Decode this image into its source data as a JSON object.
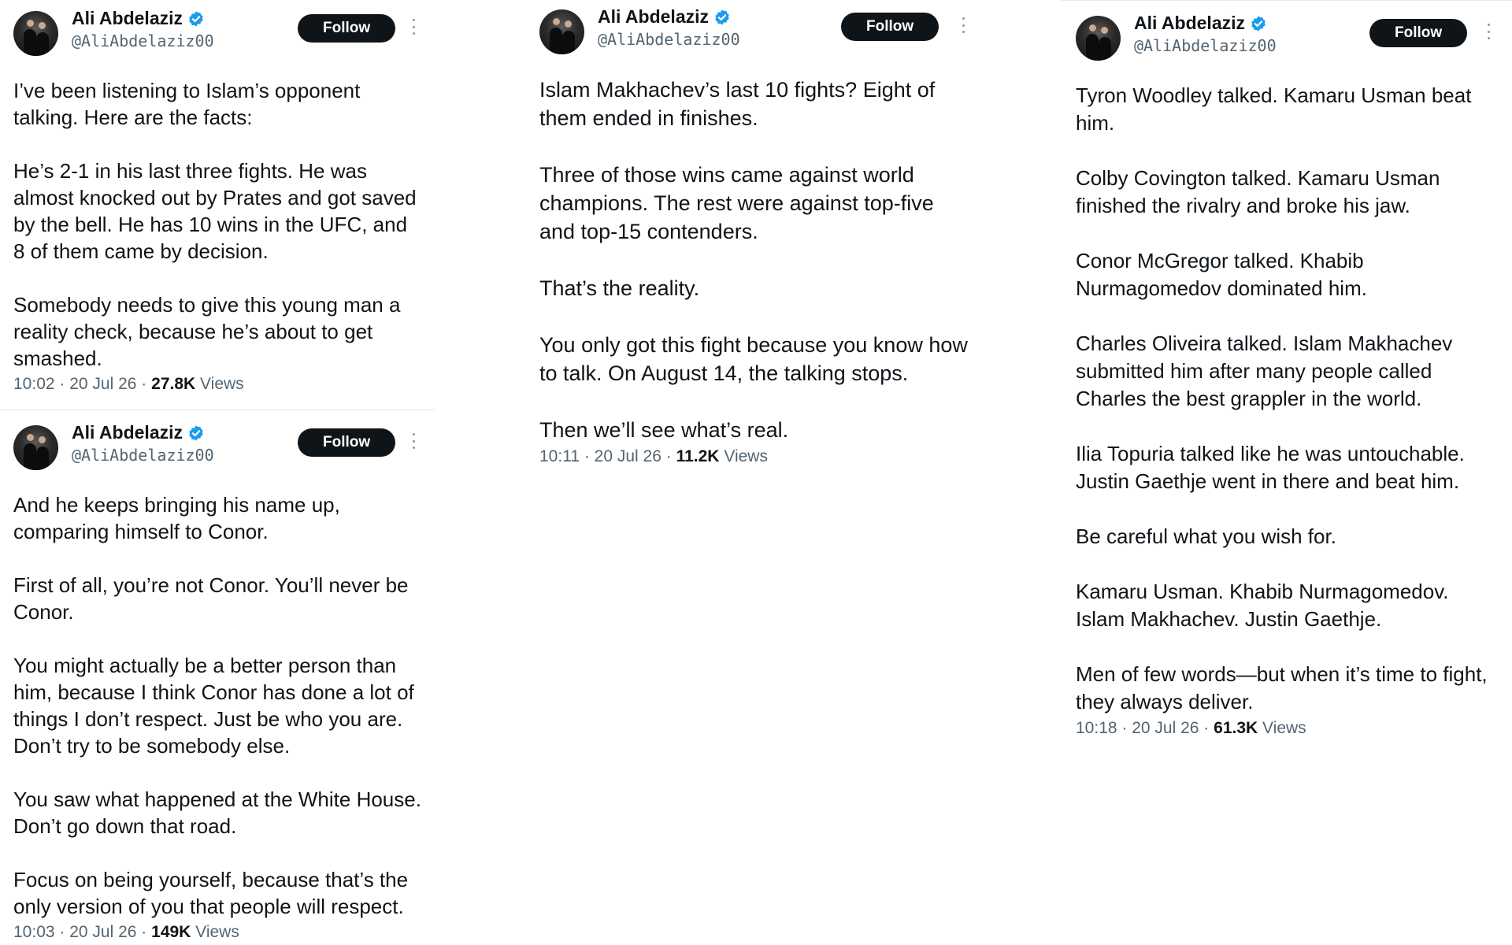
{
  "colors": {
    "text": "#0f1419",
    "secondary": "#536471",
    "verified": "#1d9bf0",
    "follow_bg": "#0f1419",
    "divider": "#e6e8ea"
  },
  "icons": [
    "verified-badge-icon",
    "more-icon"
  ],
  "tweets": [
    {
      "author": {
        "name": "Ali Abdelaziz",
        "handle": "@AliAbdelaziz00"
      },
      "follow_label": "Follow",
      "paragraphs": [
        "I’ve been listening to Islam’s opponent talking. Here are the facts:",
        "He’s 2-1 in his last three fights. He was almost knocked out by Prates and got saved by the bell. He has 10 wins in the UFC, and 8 of them came by decision.",
        "Somebody needs to give this young man a reality check, because he’s about to get smashed."
      ],
      "time": "10:02",
      "date": "20 Jul 26",
      "views_count": "27.8K",
      "views_label": "Views"
    },
    {
      "author": {
        "name": "Ali Abdelaziz",
        "handle": "@AliAbdelaziz00"
      },
      "follow_label": "Follow",
      "paragraphs": [
        "And he keeps bringing his name up, comparing himself to Conor.",
        "First of all, you’re not Conor. You’ll never be Conor.",
        "You might actually be a better person than him, because I think Conor has done a lot of things I don’t respect. Just be who you are. Don’t try to be somebody else.",
        "You saw what happened at the White House. Don’t go down that road.",
        "Focus on being yourself, because that’s the only version of you that people will respect."
      ],
      "time": "10:03",
      "date": "20 Jul 26",
      "views_count": "149K",
      "views_label": "Views"
    },
    {
      "author": {
        "name": "Ali Abdelaziz",
        "handle": "@AliAbdelaziz00"
      },
      "follow_label": "Follow",
      "paragraphs": [
        "Islam Makhachev’s last 10 fights? Eight of them ended in finishes.",
        "Three of those wins came against world champions. The rest were against top-five and top-15 contenders.",
        "That’s the reality.",
        "You only got this fight because you know how to talk. On August 14, the talking stops.",
        "Then we’ll see what’s real."
      ],
      "time": "10:11",
      "date": "20 Jul 26",
      "views_count": "11.2K",
      "views_label": "Views"
    },
    {
      "author": {
        "name": "Ali Abdelaziz",
        "handle": "@AliAbdelaziz00"
      },
      "follow_label": "Follow",
      "paragraphs": [
        "Tyron Woodley talked. Kamaru Usman beat him.",
        "Colby Covington talked. Kamaru Usman finished the rivalry and broke his jaw.",
        "Conor McGregor talked. Khabib Nurmagomedov dominated him.",
        "Charles Oliveira talked. Islam Makhachev submitted him after many people called Charles the best grappler in the world.",
        "Ilia Topuria talked like he was untouchable. Justin Gaethje went in there and beat him.",
        "Be careful what you wish for.",
        "Kamaru Usman. Khabib Nurmagomedov. Islam Makhachev. Justin Gaethje.",
        "Men of few words—but when it’s time to fight, they always deliver."
      ],
      "time": "10:18",
      "date": "20 Jul 26",
      "views_count": "61.3K",
      "views_label": "Views"
    }
  ]
}
